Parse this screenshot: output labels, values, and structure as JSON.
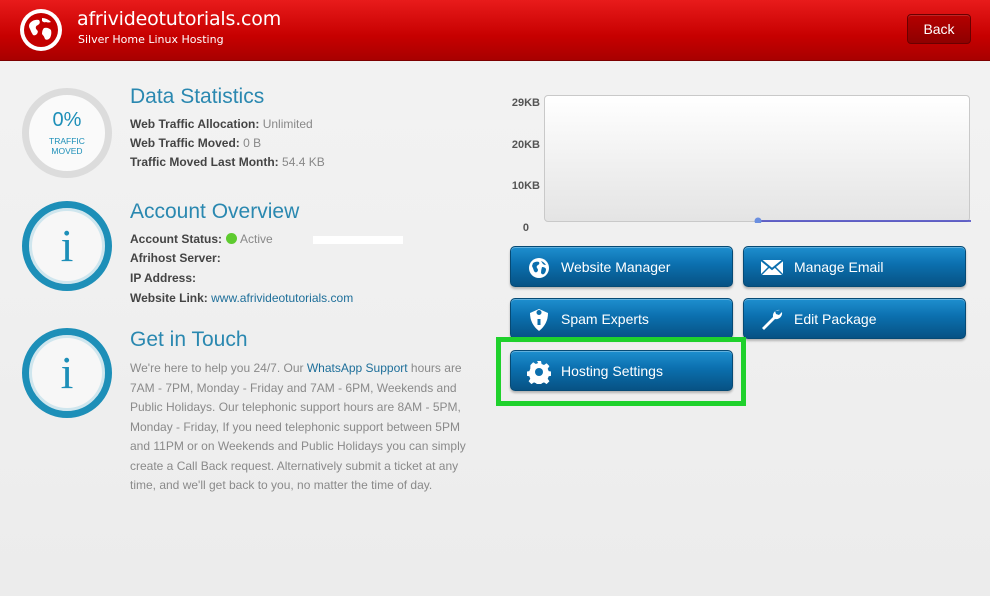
{
  "header": {
    "site_title": "afrivideotutorials.com",
    "plan": "Silver Home Linux Hosting",
    "back_label": "Back"
  },
  "data_statistics": {
    "percent": "0%",
    "percent_label_line1": "TRAFFIC",
    "percent_label_line2": "MOVED",
    "title": "Data Statistics",
    "rows": [
      {
        "label": "Web Traffic Allocation:",
        "value": "Unlimited"
      },
      {
        "label": "Web Traffic Moved:",
        "value": "0 B"
      },
      {
        "label": "Traffic Moved Last Month:",
        "value": "54.4 KB"
      }
    ]
  },
  "account_overview": {
    "title": "Account Overview",
    "status_label": "Account Status:",
    "status_value": "Active",
    "server_label": "Afrihost Server:",
    "ip_label": "IP Address:",
    "link_label": "Website Link:",
    "link_value": "www.afrivideotutorials.com"
  },
  "get_in_touch": {
    "title": "Get in Touch",
    "text_before": "We're here to help you 24/7. Our ",
    "whatsapp": "WhatsApp Support",
    "text_after": " hours are 7AM - 7PM, Monday - Friday and 7AM - 6PM, Weekends and Public Holidays. Our telephonic support hours are 8AM - 5PM, Monday - Friday, If you need telephonic support between 5PM and 11PM or on Weekends and Public Holidays you can simply create a Call Back request. Alternatively submit a ticket at any time, and we'll get back to you, no matter the time of day."
  },
  "chart_data": {
    "type": "line",
    "y_ticks": [
      "29KB",
      "20KB",
      "10KB",
      "0"
    ],
    "ylim": [
      0,
      29
    ],
    "series": [
      {
        "values": [
          0
        ]
      }
    ],
    "colors": {
      "line": "#3a3ac0",
      "point": "#6b8fe0"
    }
  },
  "actions": [
    {
      "label": "Website Manager",
      "icon": "globe-icon"
    },
    {
      "label": "Manage Email",
      "icon": "envelope-icon"
    },
    {
      "label": "Spam Experts",
      "icon": "shield-icon"
    },
    {
      "label": "Edit Package",
      "icon": "wrench-icon"
    },
    {
      "label": "Hosting Settings",
      "icon": "gear-icon"
    }
  ],
  "colors": {
    "header_red": "#d10000",
    "accent_blue": "#1d8fb8",
    "button_blue": "#0b6fae",
    "highlight_green": "#1fd12c",
    "status_green": "#5ecb2f"
  }
}
